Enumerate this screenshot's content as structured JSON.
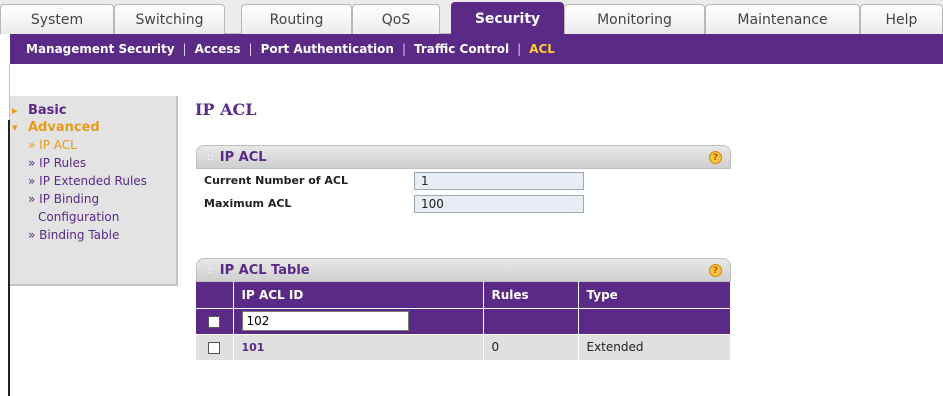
{
  "tabs": [
    {
      "label": "System",
      "active": false
    },
    {
      "label": "Switching",
      "active": false
    },
    {
      "label": "Routing",
      "active": false
    },
    {
      "label": "QoS",
      "active": false
    },
    {
      "label": "Security",
      "active": true
    },
    {
      "label": "Monitoring",
      "active": false
    },
    {
      "label": "Maintenance",
      "active": false
    },
    {
      "label": "Help",
      "active": false
    }
  ],
  "subnav": {
    "items": [
      "Management Security",
      "Access",
      "Port Authentication",
      "Traffic Control",
      "ACL"
    ],
    "active": "ACL"
  },
  "sidebar": {
    "basic": "Basic",
    "advanced": "Advanced",
    "items": [
      "» IP ACL",
      "» IP Rules",
      "» IP Extended Rules",
      "» IP Binding",
      "Configuration",
      "» Binding Table"
    ]
  },
  "page_title": "IP ACL",
  "acl_panel": {
    "title": "IP ACL",
    "current_label": "Current Number of ACL",
    "current_value": "1",
    "max_label": "Maximum ACL",
    "max_value": "100"
  },
  "table_panel": {
    "title": "IP ACL Table",
    "headers": [
      "IP ACL ID",
      "Rules",
      "Type"
    ],
    "input_value": "102",
    "rows": [
      {
        "id": "101",
        "rules": "0",
        "type": "Extended"
      }
    ]
  },
  "colors": {
    "brand_purple": "#5a2a86",
    "accent_orange": "#e49b1b"
  },
  "icons": {
    "help": "help-circle-icon",
    "expand": "triangle-right-icon",
    "collapse": "triangle-down-icon"
  }
}
